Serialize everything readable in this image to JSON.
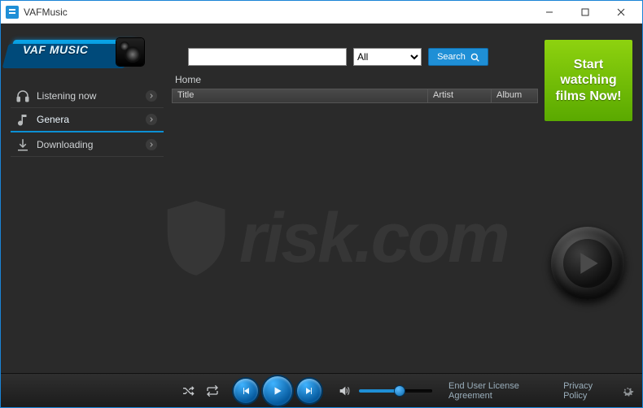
{
  "window": {
    "title": "VAFMusic"
  },
  "logo": {
    "text": "VAF MUSIC"
  },
  "search": {
    "value": "",
    "placeholder": "",
    "filter_selected": "All",
    "button_label": "Search"
  },
  "promo": {
    "text": "Start watching films Now!"
  },
  "sidebar": {
    "items": [
      {
        "label": "Listening now",
        "icon": "headphones-icon"
      },
      {
        "label": "Genera",
        "icon": "music-note-icon"
      },
      {
        "label": "Downloading",
        "icon": "download-icon"
      }
    ]
  },
  "content": {
    "breadcrumb": "Home",
    "columns": {
      "title": "Title",
      "artist": "Artist",
      "album": "Album"
    }
  },
  "footer": {
    "links": {
      "eula": "End User License Agreement",
      "privacy": "Privacy Policy"
    }
  },
  "volume": {
    "percent": 55
  }
}
